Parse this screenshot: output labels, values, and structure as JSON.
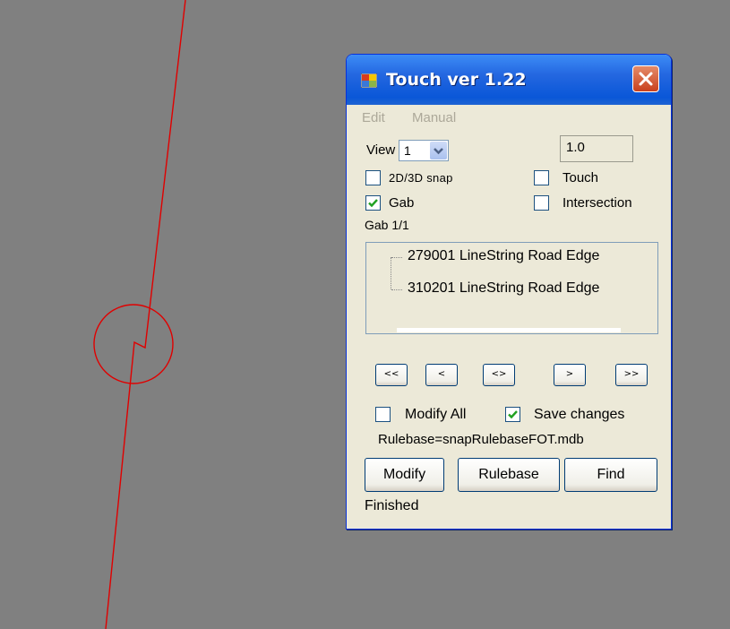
{
  "window": {
    "title": "Touch ver 1.22",
    "menu": [
      "Edit",
      "Manual"
    ]
  },
  "controls": {
    "view_label": "View",
    "view_value": "1",
    "scale_value": "1.0",
    "snap_2d3d": {
      "label": "2D/3D snap",
      "checked": false
    },
    "touch": {
      "label": "Touch",
      "checked": false
    },
    "gab": {
      "label": "Gab",
      "checked": true
    },
    "intersection": {
      "label": "Intersection",
      "checked": false
    },
    "gab_count": "Gab 1/1"
  },
  "tree_items": [
    "279001 LineString Road Edge",
    "310201 LineString Road Edge"
  ],
  "nav_buttons": [
    "<<",
    "<",
    "<>",
    ">",
    ">>"
  ],
  "options": {
    "modify_all": {
      "label": "Modify All",
      "checked": false
    },
    "save_changes": {
      "label": "Save changes",
      "checked": true
    },
    "rulebase_text": "Rulebase=snapRulebaseFOT.mdb"
  },
  "buttons": {
    "modify": "Modify",
    "rulebase": "Rulebase",
    "find": "Find"
  },
  "status": "Finished",
  "colors": {
    "canvas": "#808080",
    "line": "#e00000",
    "dialog": "#ece9d8",
    "titlebar": "#0a57d8",
    "check": "#21a121"
  },
  "icons": [
    "app-icon",
    "close-icon",
    "chevron-down-icon",
    "checkmark-icon"
  ]
}
